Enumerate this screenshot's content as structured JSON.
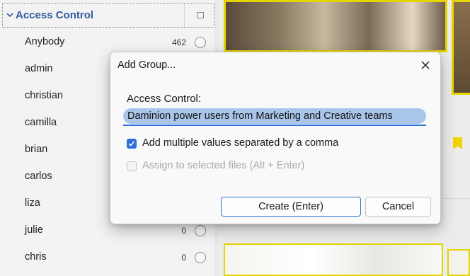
{
  "panel": {
    "title": "Access Control",
    "rows": [
      {
        "name": "Anybody",
        "count": "462"
      },
      {
        "name": "admin",
        "count": ""
      },
      {
        "name": "christian",
        "count": ""
      },
      {
        "name": "camilla",
        "count": ""
      },
      {
        "name": "brian",
        "count": ""
      },
      {
        "name": "carlos",
        "count": ""
      },
      {
        "name": "liza",
        "count": ""
      },
      {
        "name": "julie",
        "count": "0"
      },
      {
        "name": "chris",
        "count": "0"
      }
    ]
  },
  "dialog": {
    "title": "Add Group...",
    "field_label": "Access Control:",
    "field_value": "Daminion power users from Marketing and Creative teams",
    "option_multiple": {
      "label": "Add multiple values separated by a comma",
      "checked": true
    },
    "option_assign": {
      "label": "Assign to selected files (Alt + Enter)",
      "checked": false,
      "disabled": true
    },
    "create_label": "Create (Enter)",
    "cancel_label": "Cancel"
  },
  "colors": {
    "accent": "#2f6fd6",
    "panel_title": "#2f5c9e",
    "selection": "#a9c6ea",
    "tag_yellow": "#e5d400"
  },
  "icons": {
    "expand": "chevron-down-icon",
    "header_toggle": "square-icon",
    "close": "close-icon",
    "check": "checkmark-icon",
    "row_select": "radio-circle-icon",
    "marker": "bookmark-flag-icon"
  }
}
